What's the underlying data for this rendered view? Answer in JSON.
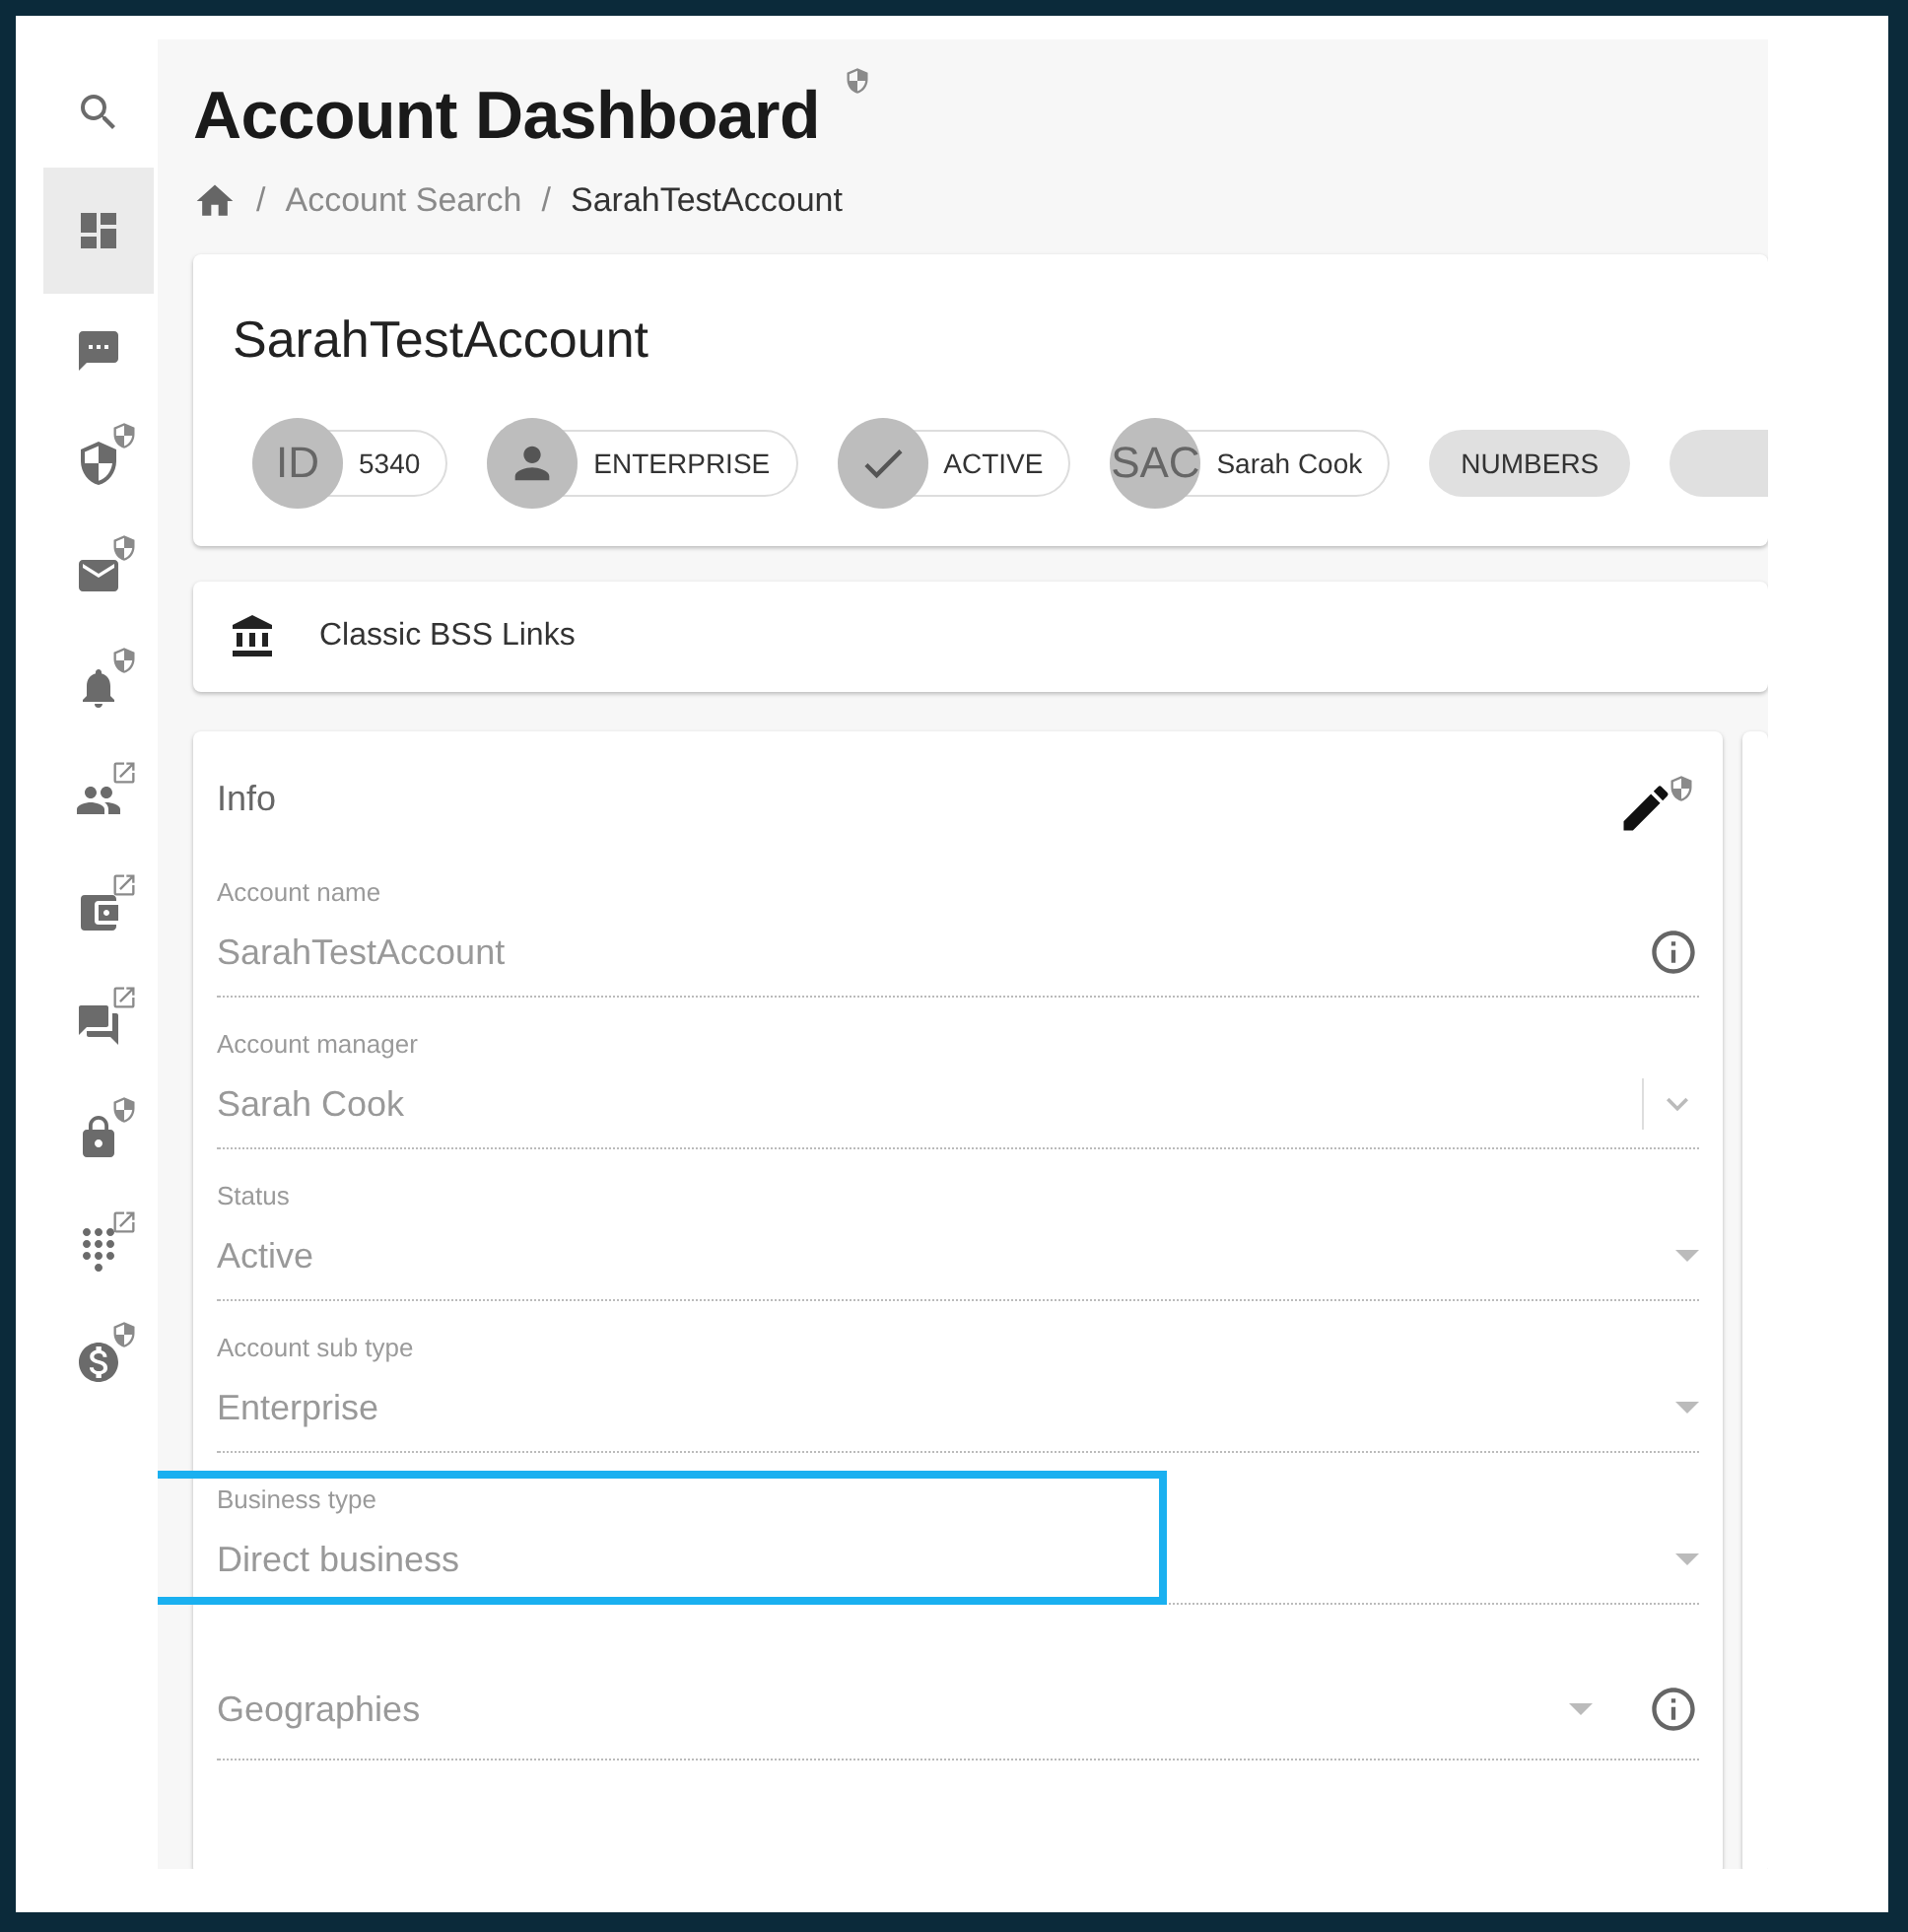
{
  "sidebar": {
    "items": [
      {
        "selected": false,
        "kind": "plain"
      },
      {
        "selected": true,
        "kind": "plain"
      },
      {
        "selected": false,
        "kind": "plain"
      },
      {
        "selected": false,
        "kind": "secured"
      },
      {
        "selected": false,
        "kind": "secured"
      },
      {
        "selected": false,
        "kind": "secured"
      },
      {
        "selected": false,
        "kind": "linked"
      },
      {
        "selected": false,
        "kind": "linked"
      },
      {
        "selected": false,
        "kind": "linked"
      },
      {
        "selected": false,
        "kind": "secured"
      },
      {
        "selected": false,
        "kind": "linked"
      },
      {
        "selected": false,
        "kind": "secured"
      }
    ]
  },
  "page": {
    "title": "Account Dashboard"
  },
  "breadcrumb": [
    {
      "separator": "/",
      "label": "Account Search",
      "current": false
    },
    {
      "separator": "/",
      "label": "SarahTestAccount",
      "current": true
    }
  ],
  "account_card": {
    "name": "SarahTestAccount",
    "chips": [
      {
        "kind": "avatar",
        "avatar": "ID",
        "label": "5340"
      },
      {
        "kind": "person",
        "label": "ENTERPRISE"
      },
      {
        "kind": "check",
        "label": "ACTIVE"
      },
      {
        "kind": "avatar",
        "avatar": "SAC",
        "label": "Sarah Cook"
      },
      {
        "kind": "filled",
        "label": "NUMBERS"
      },
      {
        "kind": "filled"
      }
    ]
  },
  "links_card": {
    "title": "Classic BSS Links"
  },
  "info_card": {
    "title": "Info",
    "fields": [
      {
        "label": "Account name",
        "value": "SarahTestAccount",
        "kind": "info",
        "highlighted": false
      },
      {
        "label": "Account manager",
        "value": "Sarah Cook",
        "kind": "combo",
        "highlighted": false
      },
      {
        "label": "Status",
        "value": "Active",
        "kind": "dropdown",
        "highlighted": false
      },
      {
        "label": "Account sub type",
        "value": "Enterprise",
        "kind": "dropdown",
        "highlighted": false
      },
      {
        "label": "Business type",
        "value": "Direct business",
        "kind": "dropdown",
        "highlighted": true
      },
      {
        "placeholder": "Geographies",
        "kind": "dropdown-info",
        "highlighted": false
      }
    ]
  }
}
